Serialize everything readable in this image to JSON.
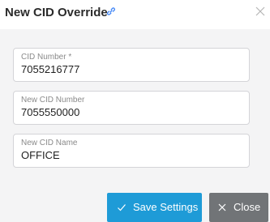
{
  "dialog": {
    "title": "New CID Override",
    "link_icon": "link-icon",
    "close_icon": "close-icon"
  },
  "fields": [
    {
      "label": "CID Number *",
      "value": "7055216777"
    },
    {
      "label": "New CID Number",
      "value": "7055550000"
    },
    {
      "label": "New CID Name",
      "value": "OFFICE"
    }
  ],
  "buttons": {
    "save": {
      "label": "Save Settings",
      "icon": "check-icon"
    },
    "close": {
      "label": "Close",
      "icon": "close-icon"
    }
  },
  "colors": {
    "primary": "#1e9bd7",
    "secondary": "#717477",
    "link": "#3b82f6",
    "body_bg": "#f4f4f5"
  }
}
